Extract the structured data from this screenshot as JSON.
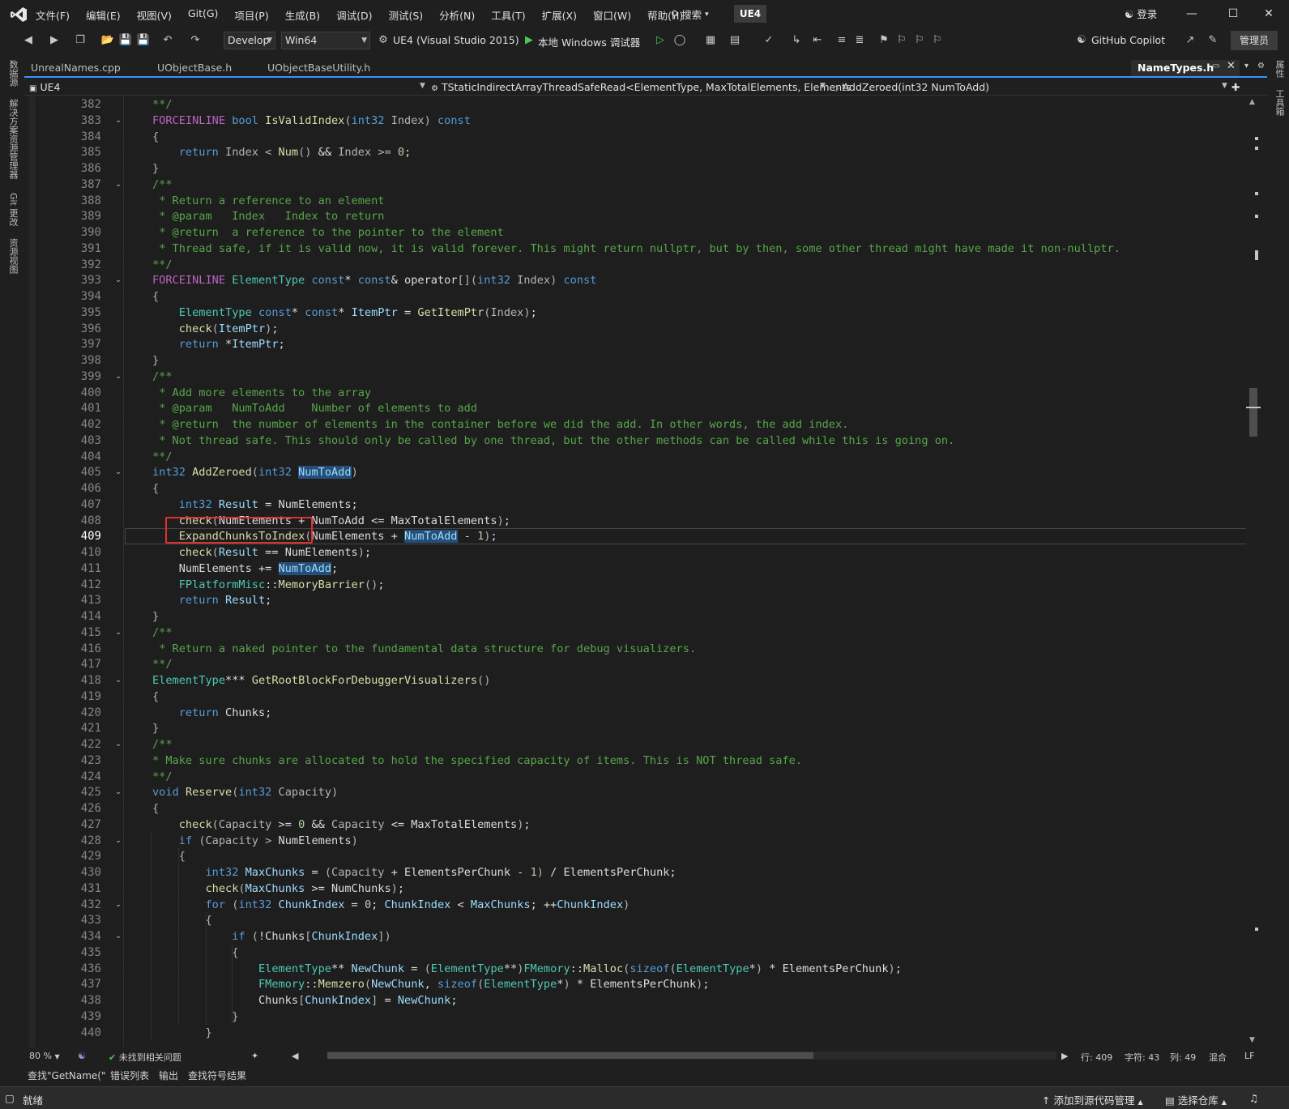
{
  "menu": {
    "items": [
      "文件(F)",
      "编辑(E)",
      "视图(V)",
      "Git(G)",
      "项目(P)",
      "生成(B)",
      "调试(D)",
      "测试(S)",
      "分析(N)",
      "工具(T)",
      "扩展(X)",
      "窗口(W)",
      "帮助(H)"
    ],
    "search": "搜索",
    "solution": "UE4",
    "login": "登录"
  },
  "toolbar": {
    "config": "Develop",
    "platform": "Win64",
    "startup_project": "UE4 (Visual Studio 2015)",
    "debugger": "本地 Windows 调试器",
    "copilot": "GitHub Copilot",
    "admin": "管理员"
  },
  "left_rail": [
    "数据源",
    "解决方案资源管理器",
    "Git 更改",
    "资源视图"
  ],
  "right_rail": [
    "属性",
    "工具箱"
  ],
  "tabs": [
    "UnrealNames.cpp",
    "UObjectBase.h",
    "UObjectBaseUtility.h",
    "NameTypes.h"
  ],
  "nav": {
    "project": "UE4",
    "scope": "TStaticIndirectArrayThreadSafeRead<ElementType, MaxTotalElements, Elements",
    "member": "AddZeroed(int32 NumToAdd)"
  },
  "editor": {
    "first_line": 382,
    "current_line": 409,
    "lines": [
      "<span class=\"c\">**/</span>",
      "<span class=\"m\">FORCEINLINE</span> <span class=\"k\">bool</span> <span class=\"f\">IsValidIndex</span><span class=\"p\">(</span><span class=\"k\">int32</span> <span class=\"p\">Index)</span> <span class=\"k\">const</span>",
      "<span class=\"p\">{</span>",
      "    <span class=\"k\">return</span> <span class=\"p\">Index &lt;</span> <span class=\"f\">Num</span><span class=\"p\">()</span> &amp;&amp; <span class=\"p\">Index &gt;=</span> <span class=\"n\">0</span>;",
      "<span class=\"p\">}</span>",
      "<span class=\"c\">/**</span>",
      " <span class=\"c\">* Return a reference to an element</span>",
      " <span class=\"c\">* @param   Index   Index to return</span>",
      " <span class=\"c\">* @return  a reference to the pointer to the element</span>",
      " <span class=\"c\">* Thread safe, if it is valid now, it is valid forever. This might return nullptr, but by then, some other thread might have made it non-nullptr.</span>",
      "<span class=\"c\">**/</span>",
      "<span class=\"m\">FORCEINLINE</span> <span class=\"t\">ElementType</span> <span class=\"k\">const</span>* <span class=\"k\">const</span>&amp; operator<span class=\"p\">[](</span><span class=\"k\">int32</span> <span class=\"p\">Index)</span> <span class=\"k\">const</span>",
      "<span class=\"p\">{</span>",
      "    <span class=\"t\">ElementType</span> <span class=\"k\">const</span>* <span class=\"k\">const</span>* <span class=\"v\">ItemPtr</span> = <span class=\"f\">GetItemPtr</span><span class=\"p\">(Index)</span>;",
      "    <span class=\"f\">check</span><span class=\"p\">(</span><span class=\"v\">ItemPtr</span><span class=\"p\">)</span>;",
      "    <span class=\"k\">return</span> *<span class=\"v\">ItemPtr</span>;",
      "<span class=\"p\">}</span>",
      "<span class=\"c\">/**</span>",
      " <span class=\"c\">* Add more elements to the array</span>",
      " <span class=\"c\">* @param   NumToAdd    Number of elements to add</span>",
      " <span class=\"c\">* @return  the number of elements in the container before we did the add. In other words, the add index.</span>",
      " <span class=\"c\">* Not thread safe. This should only be called by one thread, but the other methods can be called while this is going on.</span>",
      "<span class=\"c\">**/</span>",
      "<span class=\"k\">int32</span> <span class=\"f\">AddZeroed</span><span class=\"p\">(</span><span class=\"k\">int32</span> <span class=\"hl v\">NumToAdd</span><span class=\"p\">)</span>",
      "<span class=\"p\">{</span>",
      "    <span class=\"k\">int32</span> <span class=\"v\">Result</span> = NumElements;",
      "    <span class=\"f\">check</span><span class=\"p\">(</span>NumElements + NumToAdd &lt;= MaxTotalElements<span class=\"p\">)</span>;",
      "    <span class=\"f\">ExpandChunksToIndex</span><span class=\"p\">(</span>NumElements + <span class=\"hl v\">NumToAdd</span> - <span class=\"n\">1</span><span class=\"p\">)</span>;",
      "    <span class=\"f\">check</span><span class=\"p\">(</span><span class=\"v\">Result</span> == NumElements<span class=\"p\">)</span>;",
      "    NumElements += <span class=\"hl v\">NumToAdd</span>;",
      "    <span class=\"t\">FPlatformMisc</span>::<span class=\"f\">MemoryBarrier</span><span class=\"p\">()</span>;",
      "    <span class=\"k\">return</span> <span class=\"v\">Result</span>;",
      "<span class=\"p\">}</span>",
      "<span class=\"c\">/**</span>",
      " <span class=\"c\">* Return a naked pointer to the fundamental data structure for debug visualizers.</span>",
      "<span class=\"c\">**/</span>",
      "<span class=\"t\">ElementType</span>*** <span class=\"f\">GetRootBlockForDebuggerVisualizers</span><span class=\"p\">()</span>",
      "<span class=\"p\">{</span>",
      "    <span class=\"k\">return</span> Chunks;",
      "<span class=\"p\">}</span>",
      "<span class=\"c\">/**</span>",
      "<span class=\"c\">* Make sure chunks are allocated to hold the specified capacity of items. This is NOT thread safe.</span>",
      "<span class=\"c\">**/</span>",
      "<span class=\"k\">void</span> <span class=\"f\">Reserve</span><span class=\"p\">(</span><span class=\"k\">int32</span> <span class=\"p\">Capacity)</span>",
      "<span class=\"p\">{</span>",
      "    <span class=\"f\">check</span><span class=\"p\">(Capacity</span> &gt;= <span class=\"n\">0</span> &amp;&amp; <span class=\"p\">Capacity</span> &lt;= MaxTotalElements<span class=\"p\">)</span>;",
      "    <span class=\"k\">if</span> <span class=\"p\">(Capacity &gt;</span> NumElements<span class=\"p\">)</span>",
      "    <span class=\"p\">{</span>",
      "        <span class=\"k\">int32</span> <span class=\"v\">MaxChunks</span> = <span class=\"p\">(Capacity</span> + ElementsPerChunk - <span class=\"n\">1</span><span class=\"p\">)</span> / ElementsPerChunk;",
      "        <span class=\"f\">check</span><span class=\"p\">(</span><span class=\"v\">MaxChunks</span> &gt;= NumChunks<span class=\"p\">)</span>;",
      "        <span class=\"k\">for</span> <span class=\"p\">(</span><span class=\"k\">int32</span> <span class=\"v\">ChunkIndex</span> = <span class=\"n\">0</span>; <span class=\"v\">ChunkIndex</span> &lt; <span class=\"v\">MaxChunks</span>; ++<span class=\"v\">ChunkIndex</span><span class=\"p\">)</span>",
      "        <span class=\"p\">{</span>",
      "            <span class=\"k\">if</span> <span class=\"p\">(</span>!Chunks<span class=\"p\">[</span><span class=\"v\">ChunkIndex</span><span class=\"p\">])</span>",
      "            <span class=\"p\">{</span>",
      "                <span class=\"t\">ElementType</span>** <span class=\"v\">NewChunk</span> = <span class=\"p\">(</span><span class=\"t\">ElementType</span>**<span class=\"p\">)</span><span class=\"t\">FMemory</span>::<span class=\"f\">Malloc</span><span class=\"p\">(</span><span class=\"k\">sizeof</span><span class=\"p\">(</span><span class=\"t\">ElementType</span>*<span class=\"p\">)</span> * ElementsPerChunk<span class=\"p\">)</span>;",
      "                <span class=\"t\">FMemory</span>::<span class=\"f\">Memzero</span><span class=\"p\">(</span><span class=\"v\">NewChunk</span>, <span class=\"k\">sizeof</span><span class=\"p\">(</span><span class=\"t\">ElementType</span>*<span class=\"p\">)</span> * ElementsPerChunk<span class=\"p\">)</span>;",
      "                Chunks<span class=\"p\">[</span><span class=\"v\">ChunkIndex</span><span class=\"p\">]</span> = <span class=\"v\">NewChunk</span>;",
      "            <span class=\"p\">}</span>",
      "        <span class=\"p\">}</span>"
    ]
  },
  "status_strip": {
    "zoom": "80 %",
    "issues": "未找到相关问题",
    "line": "行: 409",
    "char": "字符: 43",
    "col": "列: 49",
    "mixed": "混合",
    "eol": "LF"
  },
  "tool_tabs": [
    "查找\"GetName(\"",
    "错误列表",
    "输出",
    "查找符号结果"
  ],
  "statusbar": {
    "ready": "就绪",
    "add_source": "添加到源代码管理",
    "select_repo": "选择仓库"
  },
  "colors": {
    "background": "#1e1e1e",
    "accent": "#3794ff",
    "highlight_box": "#e03030"
  }
}
